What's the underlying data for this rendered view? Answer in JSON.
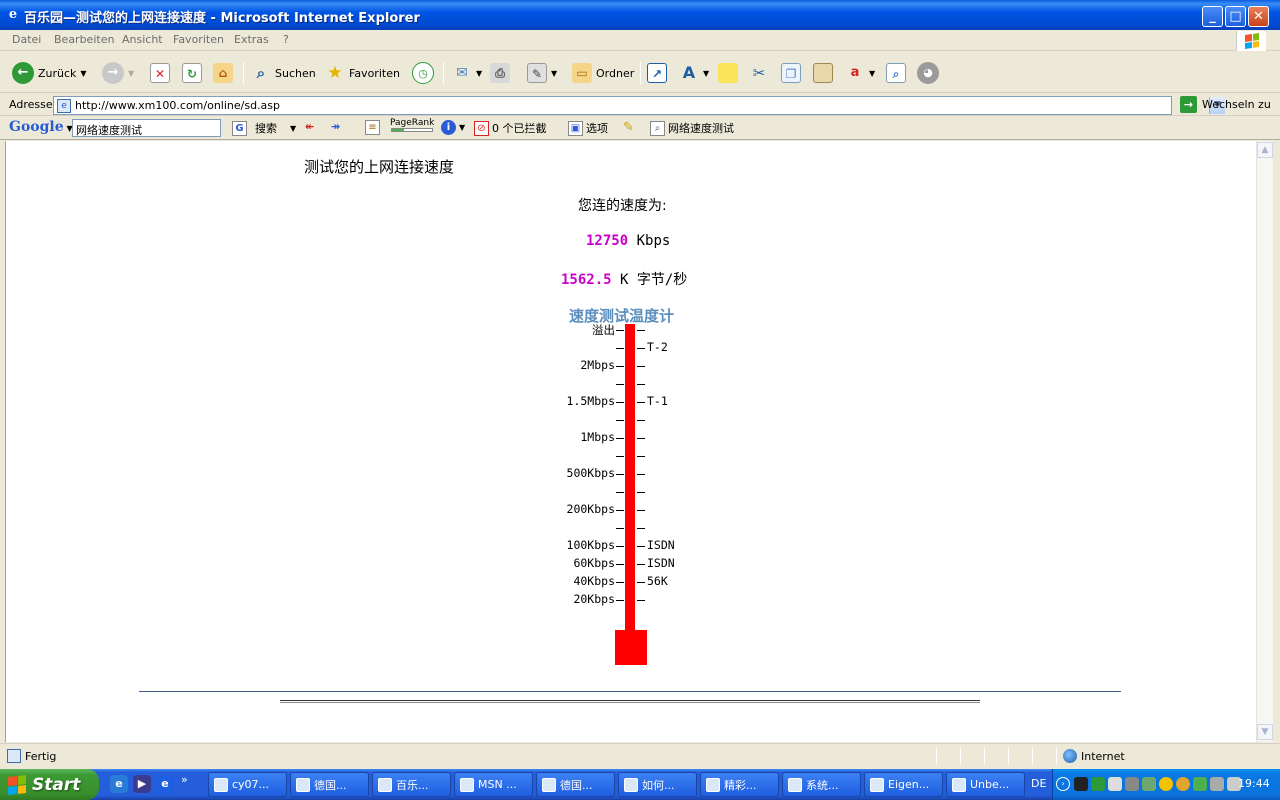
{
  "window": {
    "title": "百乐园—测试您的上网连接速度 - Microsoft Internet Explorer"
  },
  "menu": [
    "Datei",
    "Bearbeiten",
    "Ansicht",
    "Favoriten",
    "Extras",
    "?"
  ],
  "toolbar": {
    "back_label": "Zurück",
    "search_label": "Suchen",
    "favorites_label": "Favoriten",
    "folders_label": "Ordner"
  },
  "address": {
    "label": "Adresse",
    "url": "http://www.xm100.com/online/sd.asp",
    "go_label": "Wechseln zu"
  },
  "google": {
    "logo": "Google",
    "query": "网络速度测试",
    "search_label": "搜索",
    "pagerank_label": "PageRank",
    "blocked_label": "0 个已拦截",
    "options_label": "选项",
    "highlight_query": "网络速度测试"
  },
  "page": {
    "title": "测试您的上网连接速度",
    "speed_intro": "您连的速度为:",
    "kbps_value": "12750",
    "kbps_unit": "Kbps",
    "kbytes_value": "1562.5",
    "kbytes_unit": "K 字节/秒",
    "thermometer_title": "速度测试温度计",
    "thermometer_fill": 1.0,
    "scale_left": [
      "溢出",
      "",
      "2Mbps",
      "",
      "1.5Mbps",
      "",
      "1Mbps",
      "",
      "500Kbps",
      "",
      "200Kbps",
      "",
      "100Kbps",
      "60Kbps",
      "40Kbps",
      "20Kbps"
    ],
    "scale_right": [
      "",
      "T-2",
      "",
      "",
      "T-1",
      "",
      "",
      "",
      "",
      "",
      "",
      "",
      "ISDN",
      "ISDN",
      "56K",
      ""
    ]
  },
  "status": {
    "text": "Fertig",
    "zone": "Internet"
  },
  "taskbar": {
    "start_label": "Start",
    "buttons": [
      "cy07...",
      "德国...",
      "百乐...",
      "MSN ...",
      "德国...",
      "如何...",
      "精彩...",
      "系统...",
      "Eigen...",
      "Unbe..."
    ],
    "language": "DE",
    "clock": "19:44"
  },
  "colors": {
    "accent_magenta": "#cc00cc",
    "thermometer_red": "#ff0000",
    "thermo_title": "#5b8fbf"
  }
}
